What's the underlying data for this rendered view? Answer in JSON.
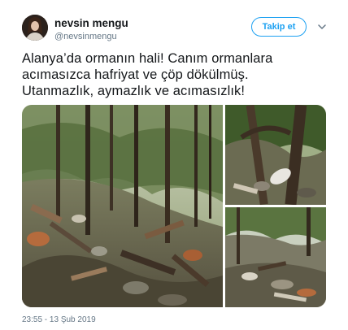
{
  "user": {
    "display_name": "nevsin mengu",
    "handle": "@nevsinmengu"
  },
  "follow_button": {
    "label": "Takip et"
  },
  "more_icon": "chevron-down-icon",
  "tweet": {
    "text": "Alanya’da ormanın hali! Canım ormanlara\nacımasızca hafriyat ve çöp dökülmüş.\nUtanmazlık, aymazlık ve acımasızlık!",
    "timestamp": "23:55 - 13 Şub 2019"
  },
  "colors": {
    "accent": "#1da1f2",
    "text": "#14171a",
    "muted": "#657786"
  }
}
